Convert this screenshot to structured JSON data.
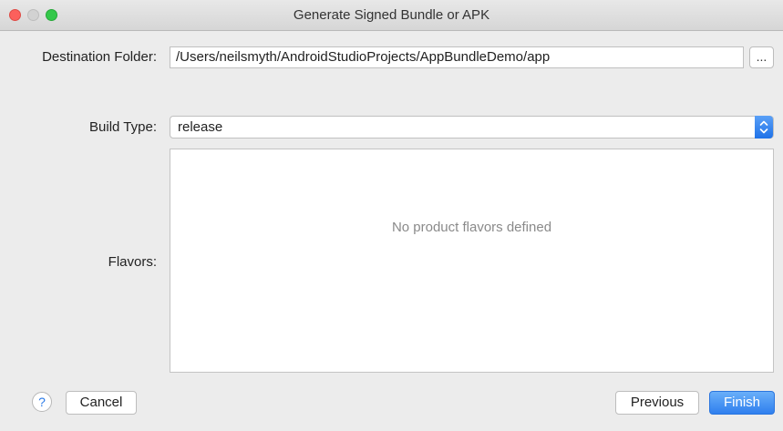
{
  "window": {
    "title": "Generate Signed Bundle or APK"
  },
  "destination": {
    "label": "Destination Folder:",
    "value": "/Users/neilsmyth/AndroidStudioProjects/AppBundleDemo/app",
    "browse_label": "..."
  },
  "build_type": {
    "label": "Build Type:",
    "selected": "release"
  },
  "flavors": {
    "label": "Flavors:",
    "empty_message": "No product flavors defined"
  },
  "footer": {
    "help_label": "?",
    "cancel_label": "Cancel",
    "previous_label": "Previous",
    "finish_label": "Finish"
  },
  "icons": {
    "close": "close-traffic-light-icon",
    "minimize": "minimize-traffic-light-icon",
    "maximize": "maximize-traffic-light-icon",
    "dropdown": "up-down-chevron-icon",
    "help": "question-mark-icon"
  },
  "colors": {
    "accent": "#2f7fee",
    "traffic_close": "#fc605c",
    "traffic_maximize": "#34c84a"
  }
}
